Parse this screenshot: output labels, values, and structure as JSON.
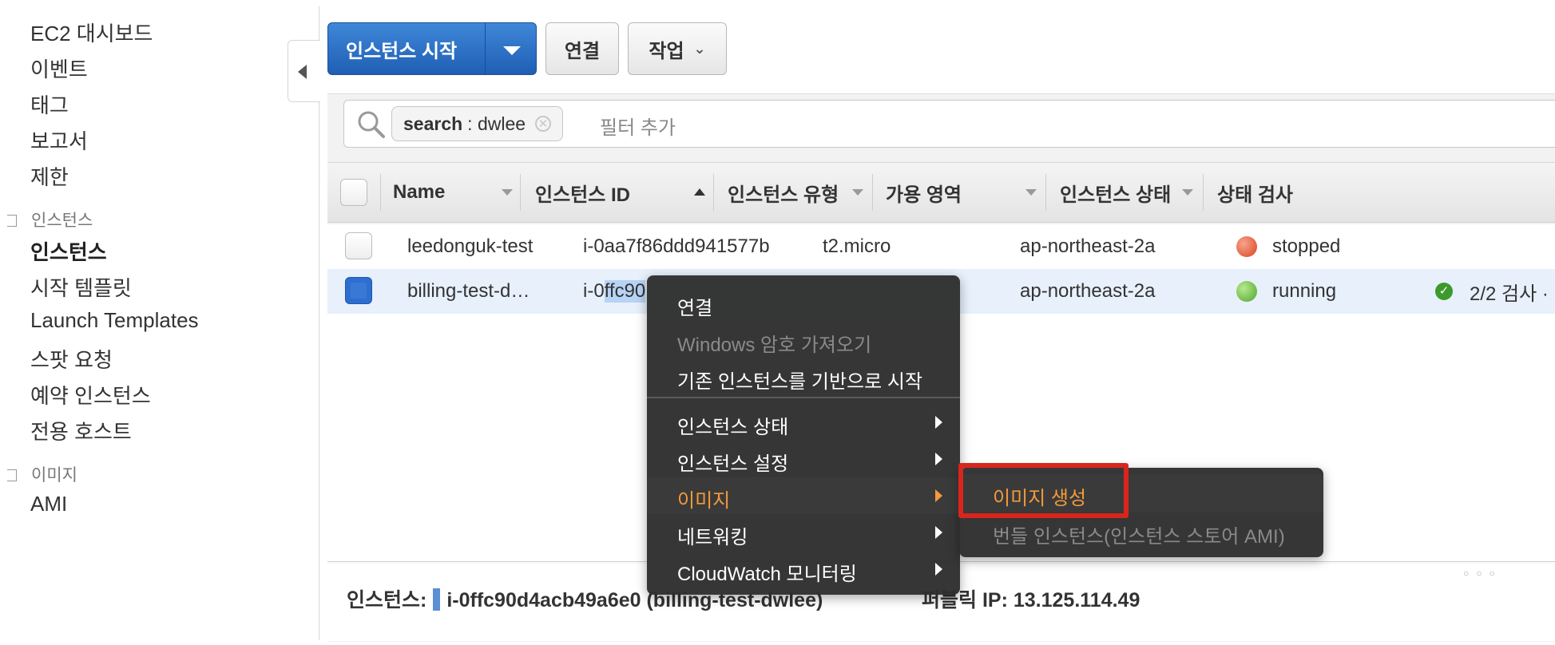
{
  "sidebar": {
    "items_top": [
      "EC2 대시보드",
      "이벤트",
      "태그",
      "보고서",
      "제한"
    ],
    "section_instances": "인스턴스",
    "items_instances": [
      "인스턴스",
      "시작 템플릿",
      "Launch Templates",
      "스팟 요청",
      "예약 인스턴스",
      "전용 호스트"
    ],
    "section_images": "이미지",
    "items_images": [
      "AMI"
    ]
  },
  "toolbar": {
    "launch_label": "인스턴스 시작",
    "connect_label": "연결",
    "actions_label": "작업"
  },
  "search": {
    "chip_key": "search",
    "chip_value": ": dwlee",
    "placeholder": "필터 추가"
  },
  "table": {
    "columns": [
      "Name",
      "인스턴스 ID",
      "인스턴스 유형",
      "가용 영역",
      "인스턴스 상태",
      "상태 검사"
    ],
    "rows": [
      {
        "name": "leedonguk-test",
        "id": "i-0aa7f86ddd941577b",
        "type": "t2.micro",
        "az": "ap-northeast-2a",
        "state": "stopped",
        "state_color": "#d9431f",
        "check": ""
      },
      {
        "name": "billing-test-d…",
        "id_prefix": "i-0",
        "id_highlight": "ffc90",
        "type": "",
        "az": "ap-northeast-2a",
        "state": "running",
        "state_color": "#4ea52a",
        "check": "2/2 검사 ·"
      }
    ]
  },
  "details": {
    "label": "인스턴스:",
    "instance": "i-0ffc90d4acb49a6e0 (billing-test-dwlee)",
    "public_ip_label": "퍼블릭 IP:",
    "public_ip": "13.125.114.49"
  },
  "context_menu": {
    "items": [
      {
        "label": "연결",
        "disabled": false,
        "submenu": false
      },
      {
        "label": "Windows 암호 가져오기",
        "disabled": true,
        "submenu": false
      },
      {
        "label": "기존 인스턴스를 기반으로 시작",
        "disabled": false,
        "submenu": false
      },
      {
        "label": "인스턴스 상태",
        "disabled": false,
        "submenu": true
      },
      {
        "label": "인스턴스 설정",
        "disabled": false,
        "submenu": true
      },
      {
        "label": "이미지",
        "disabled": false,
        "submenu": true,
        "active": true
      },
      {
        "label": "네트워킹",
        "disabled": false,
        "submenu": true
      },
      {
        "label": "CloudWatch 모니터링",
        "disabled": false,
        "submenu": true
      }
    ]
  },
  "image_submenu": {
    "create_image": "이미지 생성",
    "bundle_instance": "번들 인스턴스(인스턴스 스토어 AMI)"
  },
  "colors": {
    "primary_button": "#2a6fc6",
    "menu_highlight_text": "#f39a3a",
    "callout_border": "#d9251d",
    "selected_row": "#e7f0fb"
  }
}
